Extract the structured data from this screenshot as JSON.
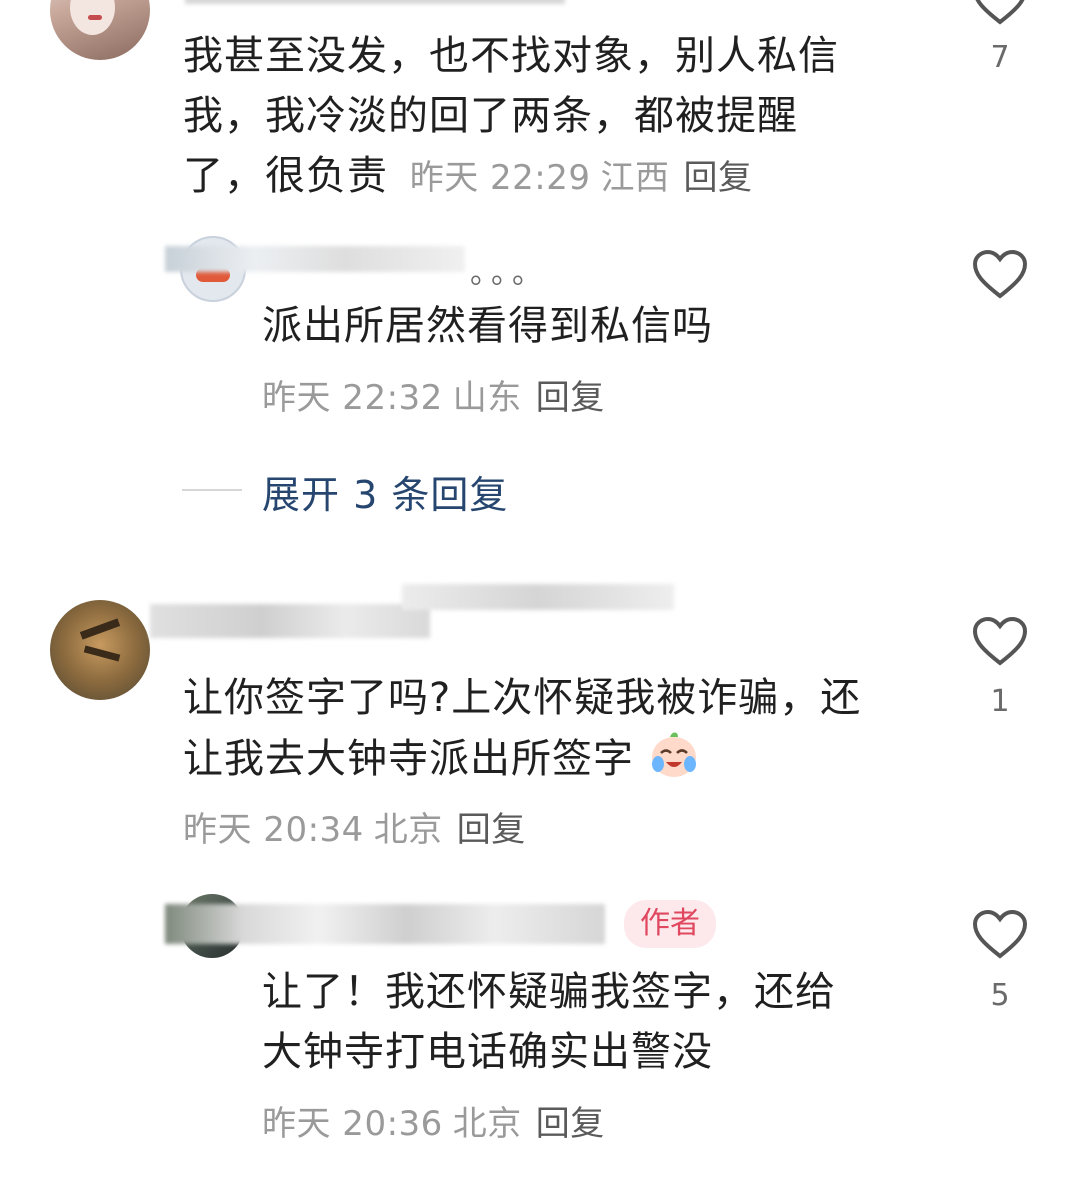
{
  "comments": [
    {
      "text": "我甚至没发，也不找对象，别人私信我，我冷淡的回了两条，都被提醒了，很负责",
      "line1": "我甚至没发，也不找对象，别人私信",
      "line2": "我，我冷淡的回了两条，都被提醒",
      "line3": "了，很负责",
      "time": "昨天 22:29",
      "location": "江西",
      "reply": "回复",
      "likes": "7"
    },
    {
      "text": "派出所居然看得到私信吗",
      "time": "昨天 22:32",
      "location": "山东",
      "reply": "回复",
      "username_suffix": "。。。"
    },
    {
      "expand": "展开 3 条回复"
    },
    {
      "line1": "让你签字了吗?上次怀疑我被诈骗，还",
      "line2": "让我去大钟寺派出所签字",
      "time": "昨天 20:34",
      "location": "北京",
      "reply": "回复",
      "likes": "1",
      "emoji": "crying-laughing-face"
    },
    {
      "line1": "让了！我还怀疑骗我签字，还给",
      "line2": "大钟寺打电话确实出警没",
      "time": "昨天 20:36",
      "location": "北京",
      "reply": "回复",
      "likes": "5",
      "badge": "作者"
    }
  ],
  "colors": {
    "author_badge_bg": "#fde9ec",
    "author_badge_text": "#e0485f",
    "expand_text": "#26466f"
  }
}
